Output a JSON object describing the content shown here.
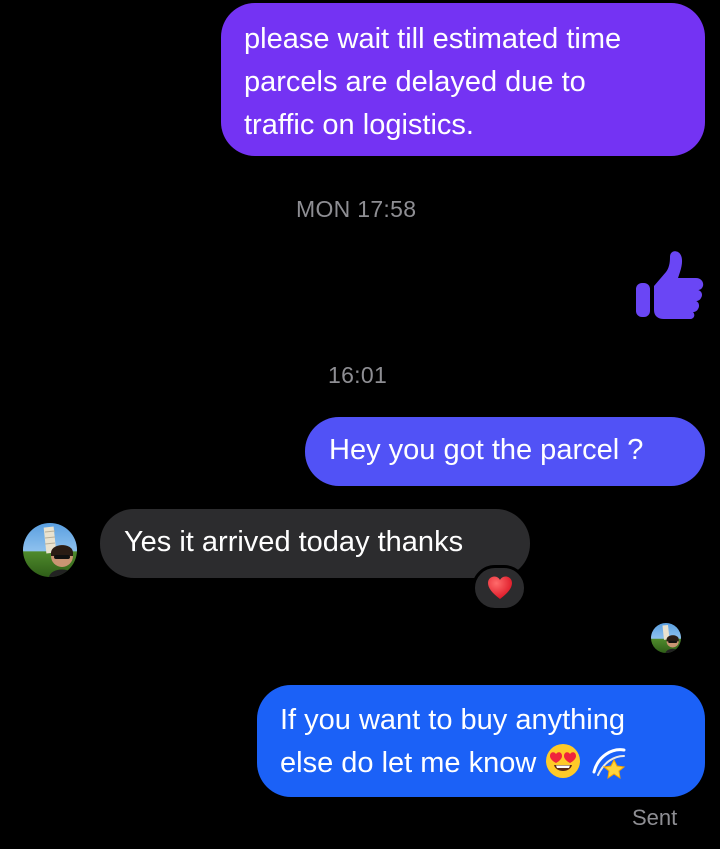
{
  "messages": [
    {
      "from": "me",
      "lines": [
        "please wait till estimated time",
        "parcels are delayed due to",
        "traffic on logistics."
      ]
    },
    {
      "from": "me",
      "text": "Hey you got the parcel ?"
    },
    {
      "from": "them",
      "text": "Yes it arrived today thanks",
      "reaction": "heart-icon"
    },
    {
      "from": "me",
      "lines": [
        "If you want to buy anything",
        "else do let me know"
      ],
      "emojis": [
        "heart-eyes-emoji",
        "dizzy-star-emoji"
      ]
    }
  ],
  "timestamps": [
    "MON 17:58",
    "16:01"
  ],
  "like_icon": "thumbs-up-icon",
  "status": "Sent",
  "colors": {
    "background": "#000000",
    "bubble_purple": "#7433f3",
    "bubble_indigo": "#5152f6",
    "bubble_blue": "#1b61f7",
    "bubble_received": "#2c2c2e",
    "timestamp": "#8e8e93",
    "like": "#6a46f5"
  }
}
